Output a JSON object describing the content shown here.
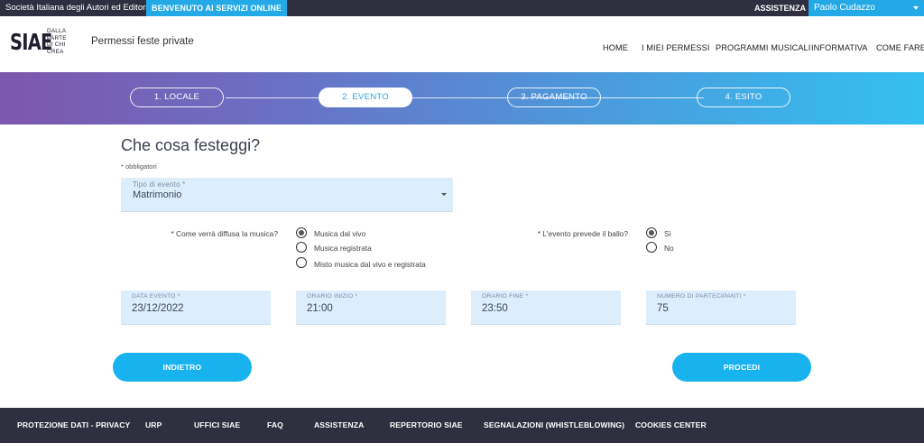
{
  "topbar": {
    "org_name": "Società Italiana degli Autori ed Editori",
    "welcome": "BENVENUTO AI SERVIZI ONLINE",
    "assistance": "ASSISTENZA",
    "user_name": "Paolo Cudazzo"
  },
  "header": {
    "logo_big": "SIAE",
    "logo_tagline": [
      "DALLA",
      "PARTE",
      "DI CHI",
      "CREA"
    ],
    "subtitle": "Permessi feste private",
    "nav": [
      "HOME",
      "I MIEI PERMESSI",
      "PROGRAMMI MUSICALI",
      "INFORMATIVA",
      "COME FARE"
    ]
  },
  "steps": [
    {
      "label": "1. LOCALE",
      "active": false
    },
    {
      "label": "2. EVENTO",
      "active": true
    },
    {
      "label": "3. PAGAMENTO",
      "active": false
    },
    {
      "label": "4. ESITO",
      "active": false
    }
  ],
  "form": {
    "title": "Che cosa festeggi?",
    "required_note": "* obbligatori",
    "event_type": {
      "label": "Tipo di evento *",
      "value": "Matrimonio"
    },
    "music_question": "* Come verrà diffusa la musica?",
    "music_options": [
      {
        "label": "Musica dal vivo",
        "checked": true
      },
      {
        "label": "Musica registrata",
        "checked": false
      },
      {
        "label": "Misto musica dal vivo e registrata",
        "checked": false
      }
    ],
    "dance_question": "* L'evento prevede il ballo?",
    "dance_options": [
      {
        "label": "Sì",
        "checked": true
      },
      {
        "label": "No",
        "checked": false
      }
    ],
    "event_date": {
      "label": "DATA EVENTO *",
      "value": "23/12/2022"
    },
    "start_time": {
      "label": "ORARIO INIZIO *",
      "value": "21:00"
    },
    "end_time": {
      "label": "ORARIO FINE *",
      "value": "23:50"
    },
    "participants": {
      "label": "NUMERO DI PARTECIPANTI *",
      "value": "75"
    },
    "back_label": "INDIETRO",
    "next_label": "PROCEDI"
  },
  "footer": {
    "links": [
      "PROTEZIONE DATI - PRIVACY",
      "URP",
      "UFFICI SIAE",
      "FAQ",
      "ASSISTENZA",
      "REPERTORIO SIAE",
      "SEGNALAZIONI (WHISTLEBLOWING)",
      "COOKIES CENTER"
    ]
  },
  "colors": {
    "accent": "#18b2ef",
    "dark_bar": "#2f2f3f",
    "field_bg": "#dcedfc",
    "gradient_start": "#7d57ad",
    "gradient_end": "#33c0ef"
  }
}
